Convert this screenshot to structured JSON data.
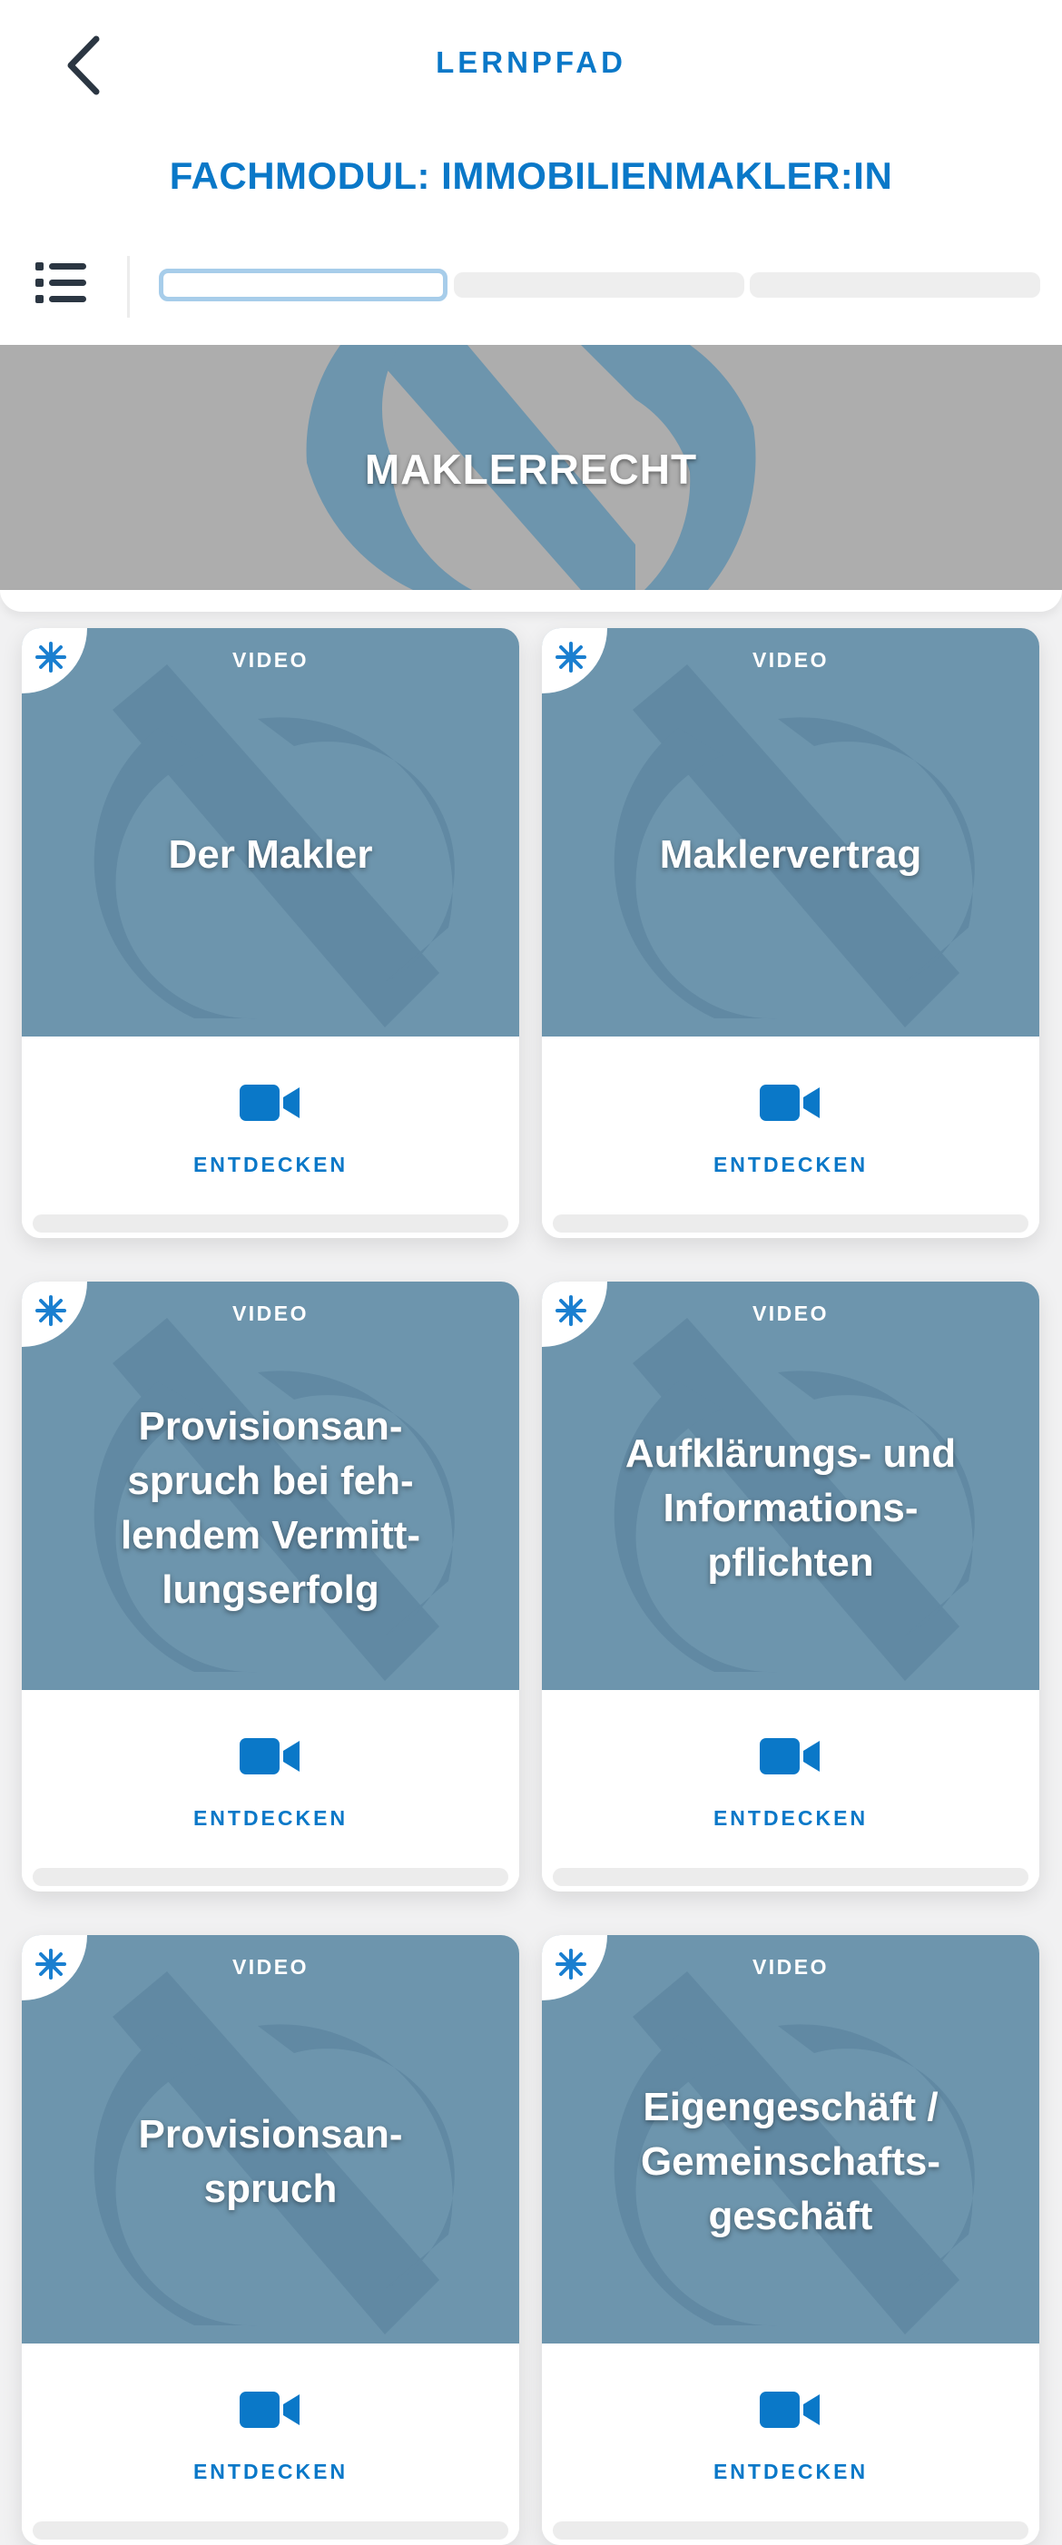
{
  "header": {
    "nav_title": "LERNPFAD",
    "module_title": "FACHMODUL: IMMOBILIENMAKLER:IN",
    "back_icon": "chevron-left-icon",
    "list_icon": "list-icon"
  },
  "progress": {
    "segments": 3,
    "active_segment": 1
  },
  "section": {
    "title": "MAKLERRECHT"
  },
  "cards": [
    {
      "badge": "VIDEO",
      "title": "Der Makler",
      "cta": "ENTDECKEN",
      "icon": "video-camera-icon"
    },
    {
      "badge": "VIDEO",
      "title": "Maklervertrag",
      "cta": "ENTDECKEN",
      "icon": "video-camera-icon"
    },
    {
      "badge": "VIDEO",
      "title": "Provisionsan-\nspruch bei feh-\nlendem Vermitt-\nlungserfolg",
      "cta": "ENTDECKEN",
      "icon": "video-camera-icon"
    },
    {
      "badge": "VIDEO",
      "title": "Aufklärungs- und\nInformations-\npflichten",
      "cta": "ENTDECKEN",
      "icon": "video-camera-icon"
    },
    {
      "badge": "VIDEO",
      "title": "Provisionsan-\nspruch",
      "cta": "ENTDECKEN",
      "icon": "video-camera-icon"
    },
    {
      "badge": "VIDEO",
      "title": "Eigengeschäft /\nGemeinschafts-\ngeschäft",
      "cta": "ENTDECKEN",
      "icon": "video-camera-icon"
    }
  ],
  "colors": {
    "accent": "#0a78c8",
    "card_bg": "#6d95ad",
    "hero_bg": "#adadad",
    "progress_active_border": "#a7cdea",
    "star": "#1a7fd0"
  }
}
